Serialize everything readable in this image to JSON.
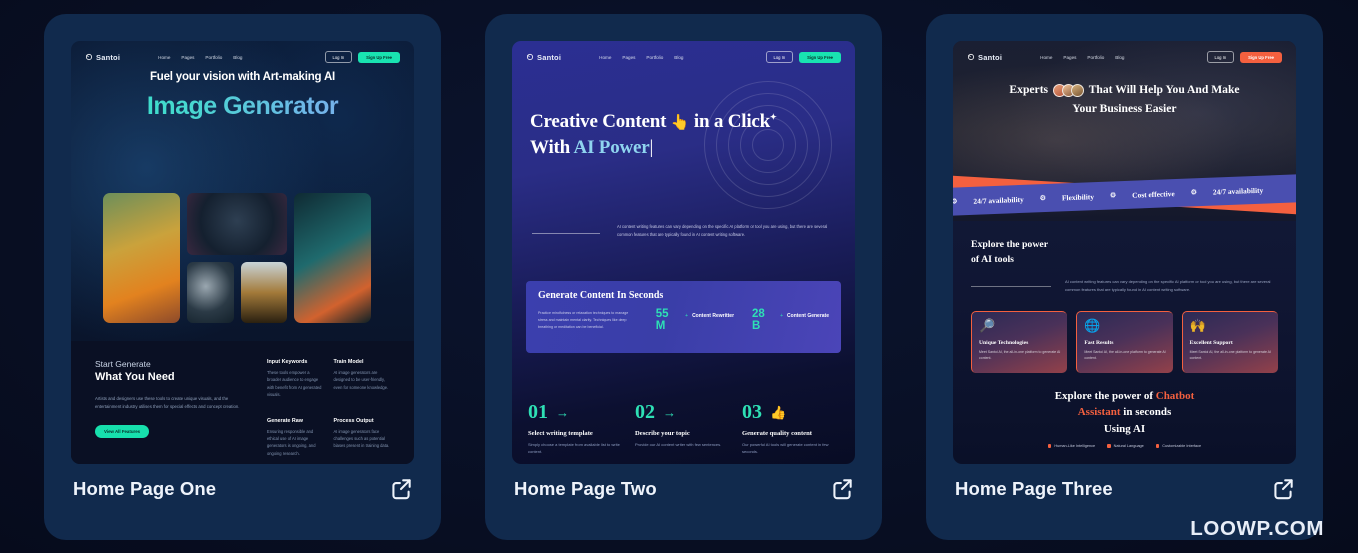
{
  "watermark": "LOOWP.COM",
  "brand": {
    "name": "Santoi",
    "accent_teal": "#19e3b1",
    "accent_coral": "#f4603f",
    "page_bg": "#080f24",
    "card_bg": "#112a4d"
  },
  "nav": {
    "links": [
      "Home",
      "Pages",
      "Portfolio",
      "Blog"
    ],
    "login": "Log In",
    "signup": "Sign Up Free"
  },
  "cards": [
    {
      "caption": "Home Page One",
      "external_link_icon": "external-link-icon",
      "hero": {
        "subtitle": "Fuel your vision with Art-making AI",
        "title": "Image Generator"
      },
      "lower": {
        "eyebrow": "Start Generate",
        "heading": "What You Need",
        "paragraph": "Artists and designers use these tools to create unique visuals, and the entertainment industry utilises them for special effects and concept creation.",
        "cta": "View All Features",
        "features": [
          {
            "title": "Input Keywords",
            "text": "These tools empower a broader audience to engage with benefit from AI generated visuals."
          },
          {
            "title": "Train Model",
            "text": "AI image generators are designed to be user-friendly, even for someone knowledge."
          },
          {
            "title": "Generate Raw",
            "text": "Ensuring responsible and ethical use of AI image generators is ongoing, and ongoing research."
          },
          {
            "title": "Process Output",
            "text": "AI image generators face challenges such as potential biases present in training data."
          }
        ]
      }
    },
    {
      "caption": "Home Page Two",
      "external_link_icon": "external-link-icon",
      "hero": {
        "line1_a": "Creative Content",
        "cursor_icon": "pointing-hand-icon",
        "line1_b": "in a Click",
        "line2_a": "With",
        "line2_ai": "AI Power",
        "caret": "|",
        "description": "AI content writing features can vary depending on the specific AI platform or tool you are using, but there are several common features that are typically found in AI content writing software."
      },
      "panel": {
        "heading": "Generate Content In Seconds",
        "mini_text": "Practice mindfulness or relaxation techniques to manage stress and maintain mental clarity. Techniques like deep breathing or meditation can be beneficial.",
        "stats": [
          {
            "value": "55 M",
            "plus": "+",
            "label": "Content Rewritter"
          },
          {
            "value": "28 B",
            "plus": "+",
            "label": "Content Generate"
          }
        ]
      },
      "steps": [
        {
          "num": "01",
          "icon": "arrow-right-icon",
          "title": "Select writing template",
          "text": "Simply choose a template from available list to write content."
        },
        {
          "num": "02",
          "icon": "arrow-right-icon",
          "title": "Describe your topic",
          "text": "Provide our AI content writer with few sentences."
        },
        {
          "num": "03",
          "icon": "thumbs-up-icon",
          "title": "Generate quality content",
          "text": "Our powerful AI tools will generate content in few seconds."
        }
      ]
    },
    {
      "caption": "Home Page Three",
      "external_link_icon": "external-link-icon",
      "hero": {
        "line1_a": "Experts",
        "avatars_icon": "avatar-group-icon",
        "line1_b": "That Will Help You And Make",
        "line2": "Your Business Easier"
      },
      "ribbon": [
        "24/7 availability",
        "Flexibility",
        "Cost effective",
        "24/7 availability"
      ],
      "ribbon_icon": "gear-icon",
      "body": {
        "heading_l1": "Explore the power",
        "heading_l2": "of AI tools",
        "paragraph": "AI content writing features can vary depending on the specific AI platform or tool you are using, but there are several common features that are typically found in AI content writing software.",
        "cards": [
          {
            "icon": "fingerprint-search-icon",
            "title": "Unique Technologies",
            "text": "Meet Santoi AI, the all-in-one platform to generate AI content."
          },
          {
            "icon": "globe-network-icon",
            "title": "Fast Results",
            "text": "Meet Santoi AI, the all-in-one platform to generate AI content."
          },
          {
            "icon": "hands-sparkle-icon",
            "title": "Excellent Support",
            "text": "Meet Santoi AI, the all-in-one platform to generate AI content."
          }
        ]
      },
      "footer": {
        "line1_a": "Explore the power of",
        "line1_hl": "Chatbot",
        "line2_hl": "Assistant",
        "line2_b": "in seconds",
        "line3": "Using AI",
        "bullets": [
          "Human-Like Intelligence",
          "Natural Language",
          "Customizable Interface"
        ]
      }
    }
  ]
}
